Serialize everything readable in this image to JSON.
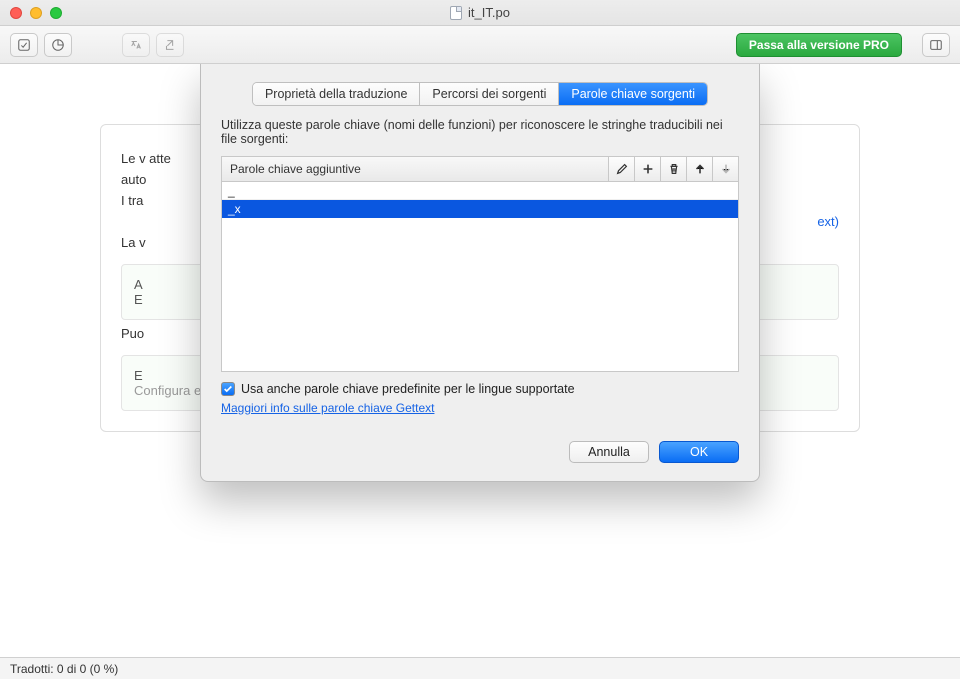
{
  "window": {
    "title": "it_IT.po"
  },
  "toolbar": {
    "btn_validate_title": "Validate",
    "btn_stats_title": "Statistics",
    "btn_translate_title": "Translate",
    "btn_export_title": "Export",
    "pro_label": "Passa alla versione PRO",
    "btn_sidebar_title": "Toggle sidebar"
  },
  "behind": {
    "line1": "Le v                                                                                                                                                       atte",
    "line2": "auto",
    "line3": "I tra",
    "line4": "La v",
    "linkfrag": "ext)",
    "card_a": "A",
    "card_b": "E",
    "pu": "Puo",
    "card_c": "E",
    "footer": "Configura estrazione codice sorgente in Proprietà."
  },
  "sheet": {
    "tabs": {
      "props": "Proprietà della traduzione",
      "paths": "Percorsi dei sorgenti",
      "keywords": "Parole chiave sorgenti"
    },
    "instr": "Utilizza queste parole chiave (nomi delle funzioni) per riconoscere le stringhe traducibili nei file sorgenti:",
    "kw_header_label": "Parole chiave aggiuntive",
    "kw_items": [
      "_",
      "_x"
    ],
    "kw_selected_index": 1,
    "chk_label": "Usa anche parole chiave predefinite per le lingue supportate",
    "chk_checked": true,
    "link_label": "Maggiori info sulle parole chiave Gettext",
    "buttons": {
      "cancel": "Annulla",
      "ok": "OK"
    }
  },
  "status": {
    "text": "Tradotti: 0 di 0 (0 %)"
  }
}
